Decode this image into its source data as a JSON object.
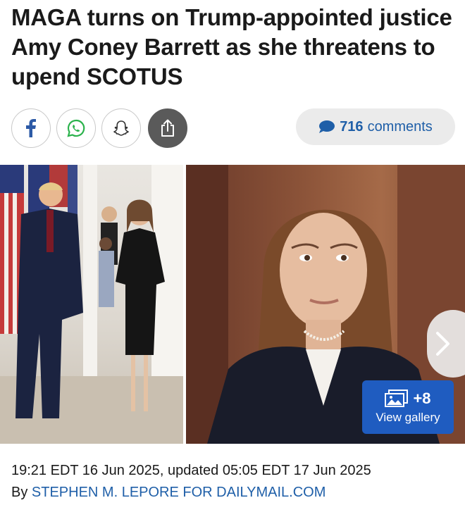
{
  "headline": "MAGA turns on Trump-appointed justice Amy Coney Barrett as she threatens to upend SCOTUS",
  "share": {
    "facebook_icon": "facebook-icon",
    "whatsapp_icon": "whatsapp-icon",
    "snapchat_icon": "snapchat-icon",
    "share_icon": "share-icon"
  },
  "comments": {
    "count": "716",
    "label": "comments",
    "icon": "comment-bubble-icon"
  },
  "gallery": {
    "more_count": "+8",
    "view_label": "View gallery",
    "next_icon": "chevron-right-icon",
    "gallery_icon": "gallery-icon"
  },
  "meta": {
    "dates": "19:21 EDT 16 Jun 2025, updated 05:05 EDT 17 Jun 2025",
    "by_prefix": "By",
    "author": "STEPHEN M. LEPORE FOR DAILYMAIL.COM"
  },
  "colors": {
    "link": "#1f5fa8",
    "badge": "#1f5cc0",
    "share_dark": "#5a5a5a"
  }
}
